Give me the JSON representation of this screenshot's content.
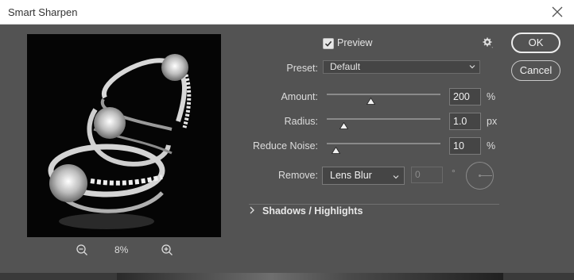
{
  "window": {
    "title": "Smart Sharpen"
  },
  "preview": {
    "checkbox_label": "Preview",
    "checked": true,
    "zoom": "8%"
  },
  "buttons": {
    "ok": "OK",
    "cancel": "Cancel"
  },
  "preset": {
    "label": "Preset:",
    "value": "Default"
  },
  "amount": {
    "label": "Amount:",
    "value": "200",
    "unit": "%",
    "slider_fraction": 0.39
  },
  "radius": {
    "label": "Radius:",
    "value": "1.0",
    "unit": "px",
    "slider_fraction": 0.15
  },
  "reduce_noise": {
    "label": "Reduce Noise:",
    "value": "10",
    "unit": "%",
    "slider_fraction": 0.08
  },
  "remove": {
    "label": "Remove:",
    "value": "Lens Blur",
    "angle": "0",
    "angle_unit": "°"
  },
  "shadows_highlights": {
    "label": "Shadows / Highlights"
  },
  "colors": {
    "dialog_bg": "#535353",
    "text": "#dcdcdc",
    "field_bg": "#454545"
  }
}
